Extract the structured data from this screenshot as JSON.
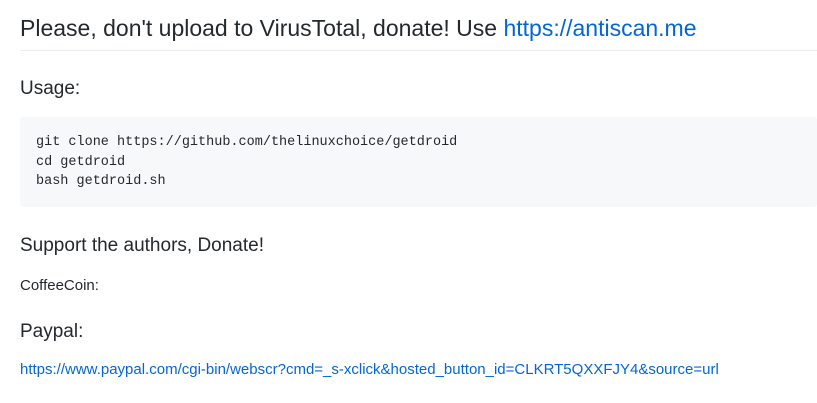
{
  "header": {
    "text": "Please, don't upload to VirusTotal, donate! Use ",
    "link_text": "https://antiscan.me"
  },
  "usage": {
    "heading": "Usage:",
    "code_lines": [
      "git clone https://github.com/thelinuxchoice/getdroid",
      "cd getdroid",
      "bash getdroid.sh"
    ]
  },
  "support": {
    "heading": "Support the authors, Donate!",
    "coffeecoin_label": "CoffeeCoin:"
  },
  "paypal": {
    "heading": "Paypal:",
    "link_text": "https://www.paypal.com/cgi-bin/webscr?cmd=_s-xclick&hosted_button_id=CLKRT5QXXFJY4&source=url"
  },
  "colors": {
    "link": "#0366d6",
    "text": "#24292e",
    "code_bg": "#f6f8fa",
    "divider": "#eaecef"
  }
}
